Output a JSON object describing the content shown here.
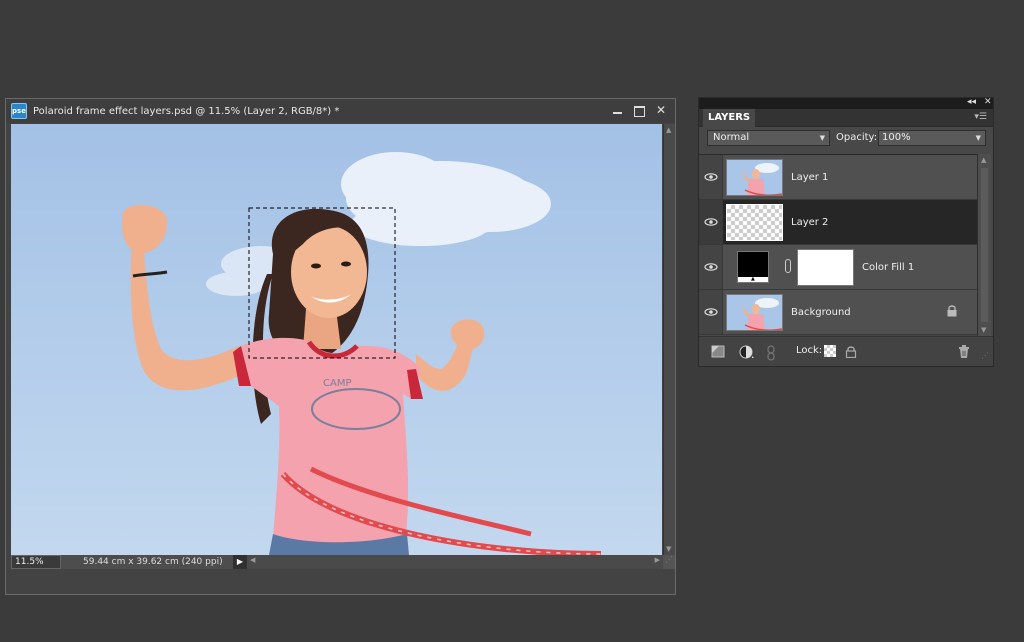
{
  "document": {
    "app_icon_label": "pse",
    "title": "Polaroid frame effect layers.psd @ 11.5% (Layer 2, RGB/8*) *",
    "zoom": "11.5%",
    "doc_size": "59.44 cm x 39.62 cm (240 ppi)"
  },
  "layers_panel": {
    "tab": "LAYERS",
    "blend_mode": "Normal",
    "opacity_label": "Opacity:",
    "opacity_value": "100%",
    "lock_label": "Lock:",
    "layers": [
      {
        "name": "Layer 1",
        "visible": true,
        "selected": false
      },
      {
        "name": "Layer 2",
        "visible": true,
        "selected": true
      },
      {
        "name": "Color Fill 1",
        "visible": true,
        "selected": false
      },
      {
        "name": "Background",
        "visible": true,
        "selected": false,
        "locked": true
      }
    ]
  },
  "colors": {
    "selected_layer_bg": "#262626",
    "sky": "#a9c6e8",
    "shirt": "#f4a2ad",
    "hoop": "#e24a4e"
  }
}
